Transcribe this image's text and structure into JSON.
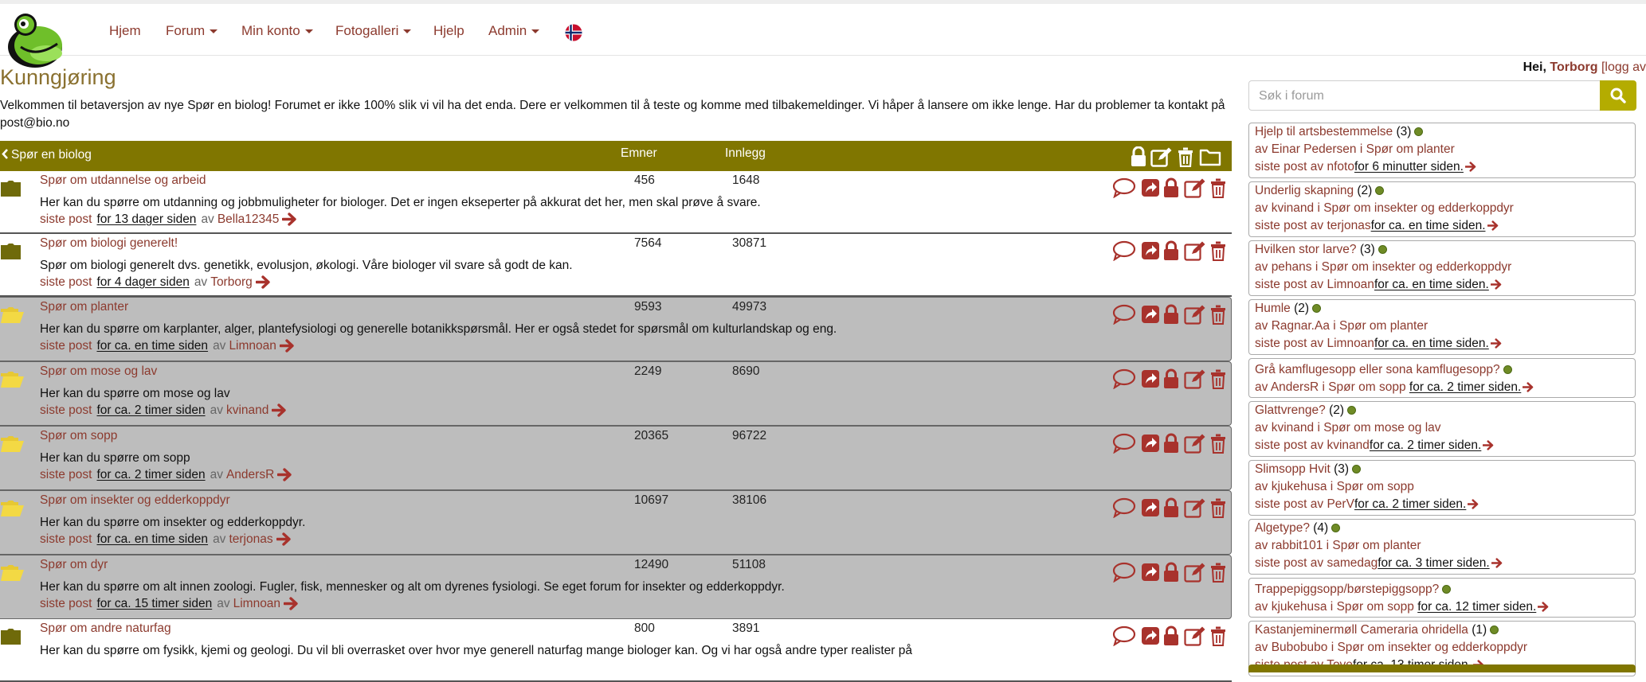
{
  "nav": {
    "items": [
      {
        "label": "Hjem",
        "dropdown": false
      },
      {
        "label": "Forum",
        "dropdown": true
      },
      {
        "label": "Min konto",
        "dropdown": true
      },
      {
        "label": "Fotogalleri",
        "dropdown": true
      },
      {
        "label": "Hjelp",
        "dropdown": false
      },
      {
        "label": "Admin",
        "dropdown": true
      }
    ],
    "flag_icon": "norway-flag-icon",
    "logo_icon": "frog-logo-icon"
  },
  "user": {
    "greeting": "Hei,",
    "name": "Torborg",
    "logout": "[logg av"
  },
  "announcement": {
    "title": "Kunngjøring",
    "text": "Velkommen til betaversjon av nye Spør en biolog! Forumet er ikke 100% slik vi vil ha det enda. Dere er velkommen til å teste og komme med tilbakemeldinger. Vi håper å lansere om ikke lenge. Har du problemer ta kontakt på post@bio.no"
  },
  "forum": {
    "back_label": "Spør en biolog",
    "col_topics": "Emner",
    "col_posts": "Innlegg",
    "last_post_label": "siste post",
    "by_label": "av",
    "colors": {
      "header": "#807600",
      "accent": "#8c3a2e",
      "row_alt": "#bdbdbd"
    },
    "rows": [
      {
        "title": "Spør om utdannelse og arbeid",
        "topics": "456",
        "posts": "1648",
        "desc": "Her kan du spørre om utdanning og jobbmuligheter for biologer. Det er ingen ekseperter på akkurat det her, men skal prøve å svare.",
        "when": "for 13 dager siden",
        "user": "Bella12345",
        "highlight": false
      },
      {
        "title": "Spør om biologi generelt!",
        "topics": "7564",
        "posts": "30871",
        "desc": "Spør om biologi generelt dvs. genetikk, evolusjon, økologi. Våre biologer vil svare så godt de kan.",
        "when": "for 4 dager siden",
        "user": "Torborg",
        "highlight": false
      },
      {
        "title": "Spør om planter",
        "topics": "9593",
        "posts": "49973",
        "desc": "Her kan du spørre om karplanter, alger, plantefysiologi og generelle botanikkspørsmål. Her er også stedet for spørsmål om kulturlandskap og eng.",
        "when": "for ca. en time siden",
        "user": "Limnoan",
        "highlight": true
      },
      {
        "title": "Spør om mose og lav",
        "topics": "2249",
        "posts": "8690",
        "desc": "Her kan du spørre om mose og lav",
        "when": "for ca. 2 timer siden",
        "user": "kvinand",
        "highlight": true
      },
      {
        "title": "Spør om sopp",
        "topics": "20365",
        "posts": "96722",
        "desc": "Her kan du spørre om sopp",
        "when": "for ca. 2 timer siden",
        "user": "AndersR",
        "highlight": true
      },
      {
        "title": "Spør om insekter og edderkoppdyr",
        "topics": "10697",
        "posts": "38106",
        "desc": "Her kan du spørre om insekter og edderkoppdyr.",
        "when": "for ca. en time siden",
        "user": "terjonas",
        "highlight": true
      },
      {
        "title": "Spør om dyr",
        "topics": "12490",
        "posts": "51108",
        "desc": "Her kan du spørre om alt innen zoologi. Fugler, fisk, mennesker og alt om dyrenes fysiologi. Se eget forum for insekter og edderkoppdyr.",
        "when": "for ca. 15 timer siden",
        "user": "Limnoan",
        "highlight": true
      },
      {
        "title": "Spør om andre naturfag",
        "topics": "800",
        "posts": "3891",
        "desc": "Her kan du spørre om fysikk, kjemi og geologi. Du vil bli overrasket over hvor mye generell naturfag mange biologer kan. Og vi har også andre typer realister på",
        "when": "",
        "user": "",
        "highlight": false
      }
    ]
  },
  "sidebar": {
    "search_placeholder": "Søk i forum",
    "search_icon": "search-icon",
    "in_label": "i",
    "last_by_label": "siste post av",
    "recent": [
      {
        "title": "Hjelp til artsbestemmelse",
        "count": "(3)",
        "author": "Einar Pedersen",
        "forum": "Spør om planter",
        "last_user": "nfoto",
        "when": "for 6 minutter siden."
      },
      {
        "title": "Underlig skapning",
        "count": "(2)",
        "author": "kvinand",
        "forum": "Spør om insekter og edderkoppdyr",
        "last_user": "terjonas",
        "when": "for ca. en time siden."
      },
      {
        "title": "Hvilken stor larve?",
        "count": "(3)",
        "author": "pehans",
        "forum": "Spør om insekter og edderkoppdyr",
        "last_user": "Limnoan",
        "when": "for ca. en time siden."
      },
      {
        "title": "Humle",
        "count": "(2)",
        "author": "Ragnar.Aa",
        "forum": "Spør om planter",
        "last_user": "Limnoan",
        "when": "for ca. en time siden."
      },
      {
        "title": "Grå kamflugesopp eller sona kamflugesopp?",
        "count": "",
        "author": "AndersR",
        "forum": "Spør om sopp",
        "last_user": "",
        "when": "for ca. 2 timer siden."
      },
      {
        "title": "Glattvrenge?",
        "count": "(2)",
        "author": "kvinand",
        "forum": "Spør om mose og lav",
        "last_user": "kvinand",
        "when": "for ca. 2 timer siden."
      },
      {
        "title": "Slimsopp Hvit",
        "count": "(3)",
        "author": "kjukehusa",
        "forum": "Spør om sopp",
        "last_user": "PerV",
        "when": "for ca. 2 timer siden."
      },
      {
        "title": "Algetype?",
        "count": "(4)",
        "author": "rabbit101",
        "forum": "Spør om planter",
        "last_user": "samedag",
        "when": "for ca. 3 timer siden."
      },
      {
        "title": "Trappepiggsopp/børstepiggsopp?",
        "count": "",
        "author": "kjukehusa",
        "forum": "Spør om sopp",
        "last_user": "",
        "when": "for ca. 12 timer siden."
      },
      {
        "title": "Kastanjeminermøll Cameraria ohridella",
        "count": "(1)",
        "author": "Bubobubo",
        "forum": "Spør om insekter og edderkoppdyr",
        "last_user": "Tove",
        "when": "for ca. 13 timer siden."
      }
    ]
  }
}
